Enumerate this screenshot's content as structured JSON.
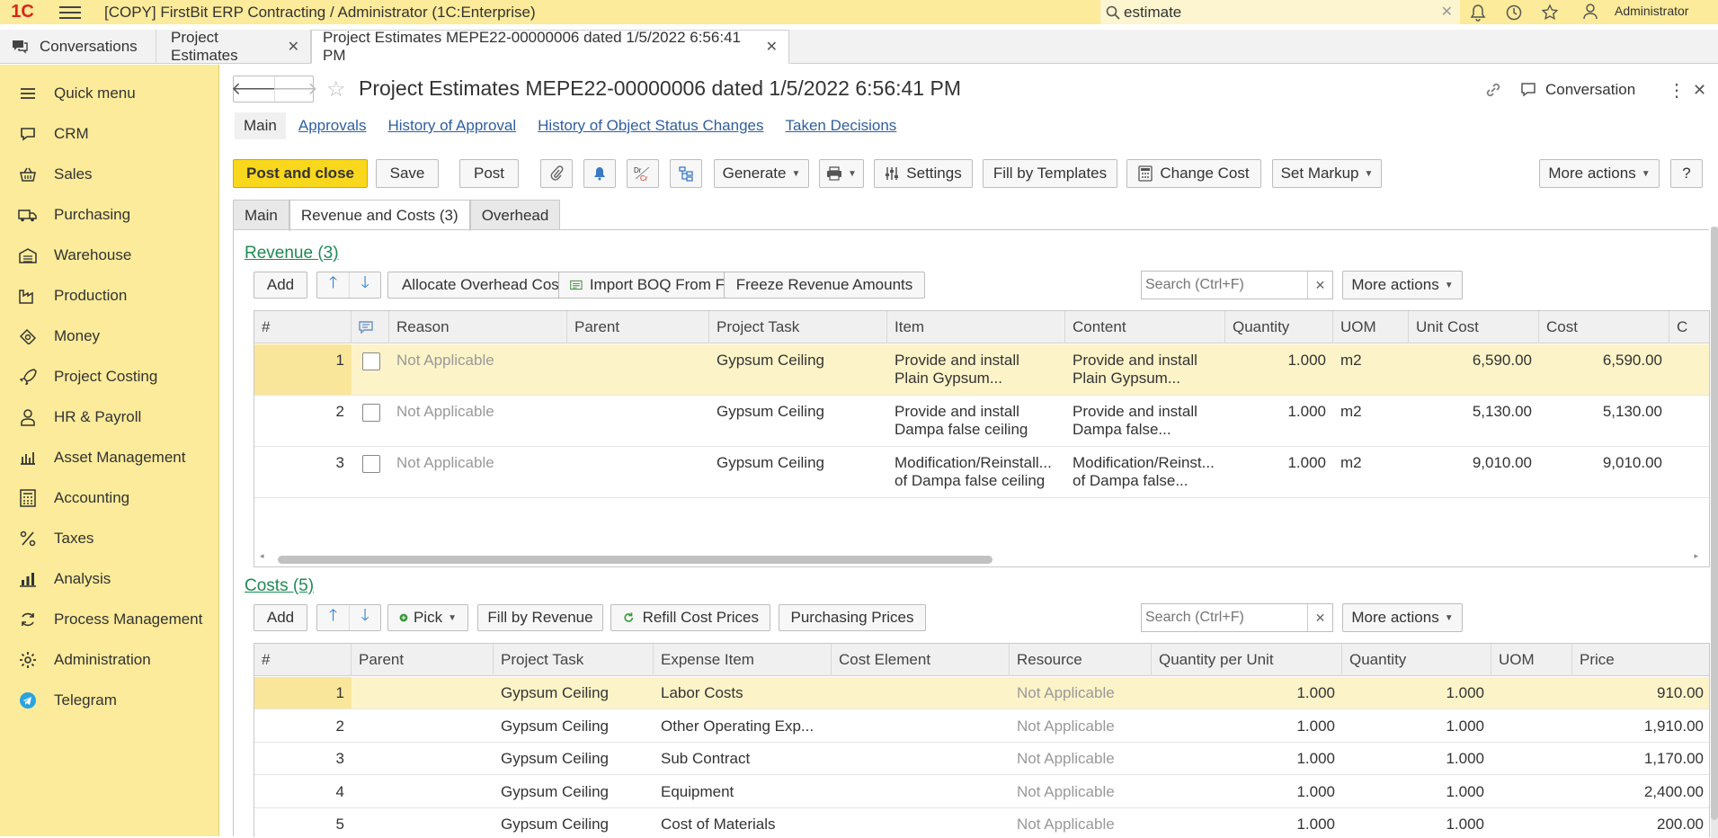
{
  "titlebar": {
    "logo": "1C",
    "title": "[COPY] FirstBit ERP Contracting / Administrator  (1C:Enterprise)",
    "search_value": "estimate",
    "user": "Administrator"
  },
  "tabs": [
    {
      "label": "Conversations"
    },
    {
      "label": "Project Estimates"
    },
    {
      "label": "Project Estimates MEPE22-00000006 dated 1/5/2022 6:56:41 PM"
    }
  ],
  "sidebar": {
    "items": [
      {
        "label": "Quick menu",
        "icon": "menu-icon"
      },
      {
        "label": "CRM",
        "icon": "chat-icon"
      },
      {
        "label": "Sales",
        "icon": "basket-icon"
      },
      {
        "label": "Purchasing",
        "icon": "truck-icon"
      },
      {
        "label": "Warehouse",
        "icon": "warehouse-icon"
      },
      {
        "label": "Production",
        "icon": "factory-icon"
      },
      {
        "label": "Money",
        "icon": "money-icon"
      },
      {
        "label": "Project Costing",
        "icon": "rocket-icon"
      },
      {
        "label": "HR & Payroll",
        "icon": "person-icon"
      },
      {
        "label": "Asset Management",
        "icon": "asset-icon"
      },
      {
        "label": "Accounting",
        "icon": "calculator-icon"
      },
      {
        "label": "Taxes",
        "icon": "percent-icon"
      },
      {
        "label": "Analysis",
        "icon": "chart-icon"
      },
      {
        "label": "Process Management",
        "icon": "process-icon"
      },
      {
        "label": "Administration",
        "icon": "gear-icon"
      },
      {
        "label": "Telegram",
        "icon": "telegram-icon"
      }
    ]
  },
  "document": {
    "title": "Project Estimates MEPE22-00000006 dated 1/5/2022 6:56:41 PM",
    "conversation_label": "Conversation",
    "link_tabs": [
      "Main",
      "Approvals",
      "History of Approval",
      "History of Object Status Changes",
      "Taken Decisions"
    ],
    "toolbar": {
      "post_close": "Post and close",
      "save": "Save",
      "post": "Post",
      "generate": "Generate",
      "settings": "Settings",
      "fill_templates": "Fill by Templates",
      "change_cost": "Change Cost",
      "set_markup": "Set Markup",
      "more_actions": "More actions",
      "help": "?"
    },
    "inner_tabs": [
      "Main",
      "Revenue and Costs (3)",
      "Overhead"
    ]
  },
  "revenue": {
    "title": "Revenue (3)",
    "buttons": {
      "add": "Add",
      "allocate": "Allocate Overhead Costs",
      "import": "Import BOQ From File",
      "freeze": "Freeze Revenue Amounts",
      "more": "More actions"
    },
    "search_placeholder": "Search (Ctrl+F)",
    "columns": [
      "#",
      "",
      "Reason",
      "Parent",
      "Project Task",
      "Item",
      "Content",
      "Quantity",
      "UOM",
      "Unit Cost",
      "Cost",
      "C"
    ],
    "rows": [
      {
        "n": "1",
        "reason": "Not Applicable",
        "parent": "",
        "task": "Gypsum Ceiling",
        "item1": "Provide and install",
        "item2": "Plain Gypsum...",
        "content1": "Provide and install",
        "content2": "Plain Gypsum...",
        "qty": "1.000",
        "uom": "m2",
        "unit_cost": "6,590.00",
        "cost": "6,590.00"
      },
      {
        "n": "2",
        "reason": "Not Applicable",
        "parent": "",
        "task": "Gypsum Ceiling",
        "item1": "Provide and install",
        "item2": "Dampa false ceiling",
        "content1": "Provide and install",
        "content2": "Dampa false...",
        "qty": "1.000",
        "uom": "m2",
        "unit_cost": "5,130.00",
        "cost": "5,130.00"
      },
      {
        "n": "3",
        "reason": "Not Applicable",
        "parent": "",
        "task": "Gypsum Ceiling",
        "item1": "Modification/Reinstall...",
        "item2": "of Dampa false ceiling",
        "content1": "Modification/Reinst...",
        "content2": "of Dampa false...",
        "qty": "1.000",
        "uom": "m2",
        "unit_cost": "9,010.00",
        "cost": "9,010.00"
      }
    ]
  },
  "costs": {
    "title": "Costs (5)",
    "buttons": {
      "add": "Add",
      "pick": "Pick",
      "fill_revenue": "Fill by Revenue",
      "refill": "Refill Cost Prices",
      "purchasing": "Purchasing Prices",
      "more": "More actions"
    },
    "search_placeholder": "Search (Ctrl+F)",
    "columns": [
      "#",
      "Parent",
      "Project Task",
      "Expense Item",
      "Cost Element",
      "Resource",
      "Quantity per Unit",
      "Quantity",
      "UOM",
      "Price"
    ],
    "rows": [
      {
        "n": "1",
        "parent": "",
        "task": "Gypsum Ceiling",
        "expense": "Labor Costs",
        "element": "",
        "resource": "Not Applicable",
        "qpu": "1.000",
        "qty": "1.000",
        "uom": "",
        "price": "910.00"
      },
      {
        "n": "2",
        "parent": "",
        "task": "Gypsum Ceiling",
        "expense": "Other Operating Exp...",
        "element": "",
        "resource": "Not Applicable",
        "qpu": "1.000",
        "qty": "1.000",
        "uom": "",
        "price": "1,910.00"
      },
      {
        "n": "3",
        "parent": "",
        "task": "Gypsum Ceiling",
        "expense": "Sub Contract",
        "element": "",
        "resource": "Not Applicable",
        "qpu": "1.000",
        "qty": "1.000",
        "uom": "",
        "price": "1,170.00"
      },
      {
        "n": "4",
        "parent": "",
        "task": "Gypsum Ceiling",
        "expense": "Equipment",
        "element": "",
        "resource": "Not Applicable",
        "qpu": "1.000",
        "qty": "1.000",
        "uom": "",
        "price": "2,400.00"
      },
      {
        "n": "5",
        "parent": "",
        "task": "Gypsum Ceiling",
        "expense": "Cost of Materials",
        "element": "",
        "resource": "Not Applicable",
        "qpu": "1.000",
        "qty": "1.000",
        "uom": "",
        "price": "200.00"
      }
    ]
  },
  "colors": {
    "accent_yellow": "#f9d71c",
    "sidebar_bg": "#fbeb9a",
    "link_blue": "#2f5f9f",
    "section_green": "#1f8a55"
  }
}
